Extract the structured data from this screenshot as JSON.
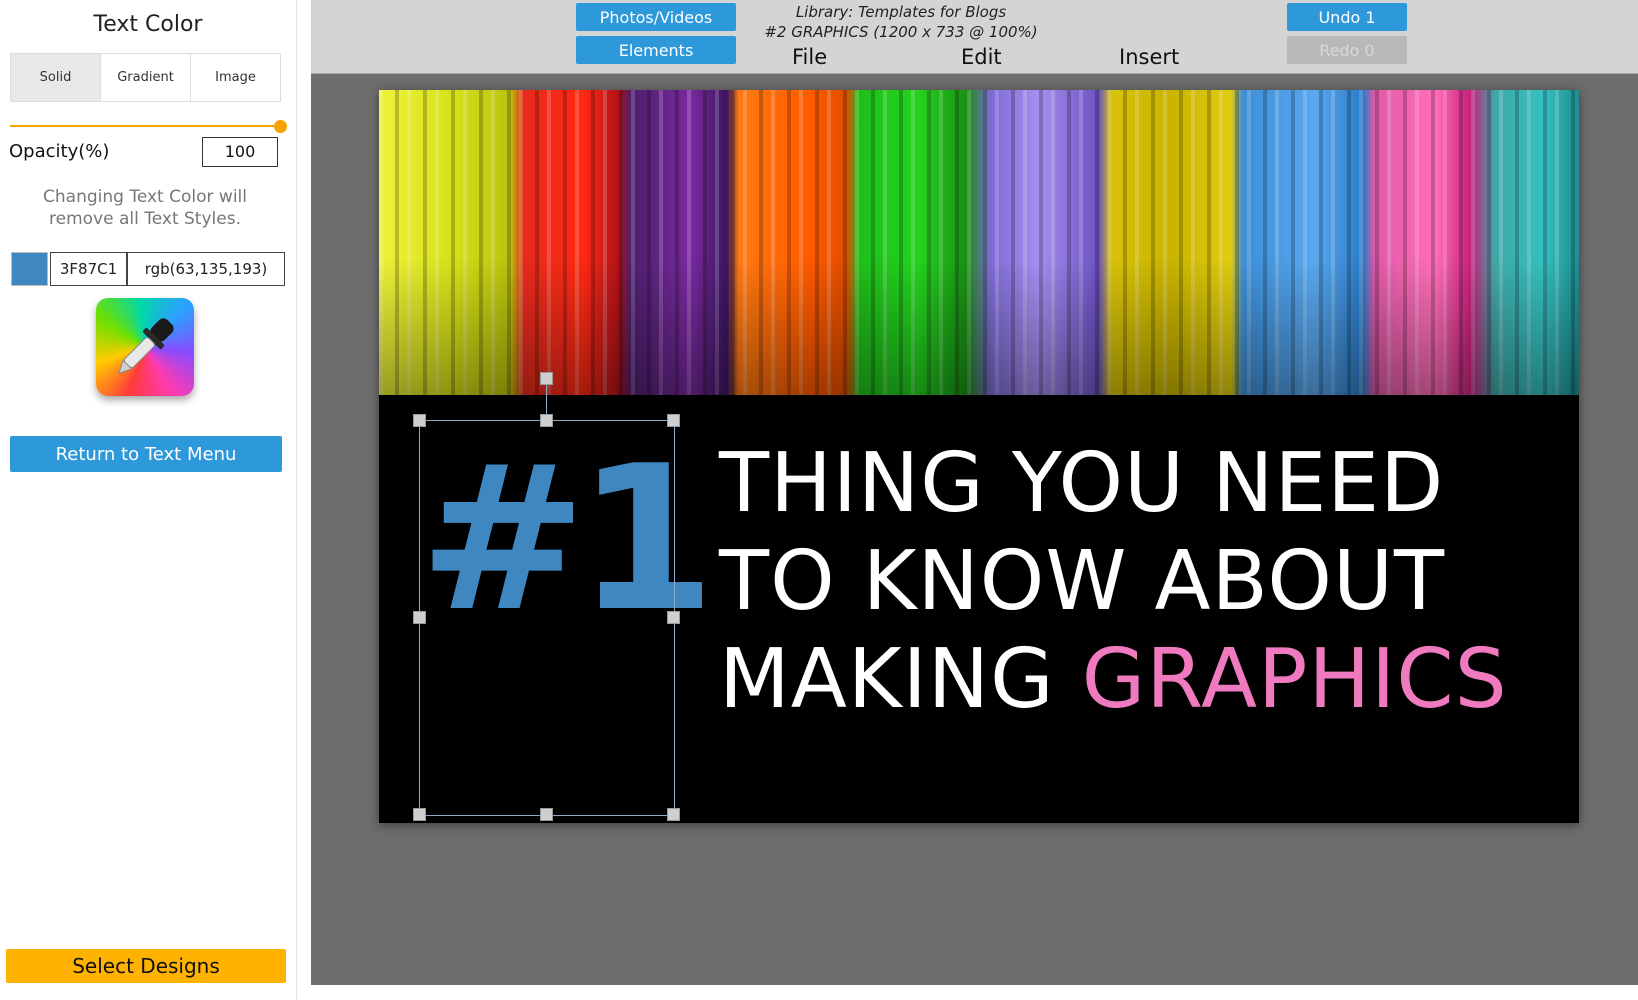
{
  "sidebar": {
    "title": "Text Color",
    "tabs": [
      "Solid",
      "Gradient",
      "Image"
    ],
    "opacity_label": "Opacity(%)",
    "opacity_value": "100",
    "opacity_fraction": 1.0,
    "note_line1": "Changing Text Color will",
    "note_line2": "remove all Text Styles.",
    "color_hex": "3F87C1",
    "color_rgb": "rgb(63,135,193)",
    "swatch_color": "#3F87C1",
    "picker_icon": "eyedropper-icon",
    "return_button": "Return to Text Menu",
    "select_designs_button": "Select Designs"
  },
  "toolbar": {
    "photos_videos": "Photos/Videos",
    "elements": "Elements",
    "menus": [
      "File",
      "Edit",
      "Insert"
    ],
    "library_line1": "Library: Templates for Blogs",
    "library_line2": "#2 GRAPHICS (1200 x 733 @ 100%)",
    "undo": "Undo 1",
    "redo": "Redo 0"
  },
  "canvas": {
    "big_number": "#1",
    "headline_line1": "THING YOU NEED",
    "headline_line2": "TO KNOW ABOUT",
    "headline_line3_a": "MAKING ",
    "headline_line3_b": "GRAPHICS",
    "colors": {
      "number": "#3F87C1",
      "headline": "#ffffff",
      "accent": "#f07ac0",
      "background": "#000000"
    }
  }
}
